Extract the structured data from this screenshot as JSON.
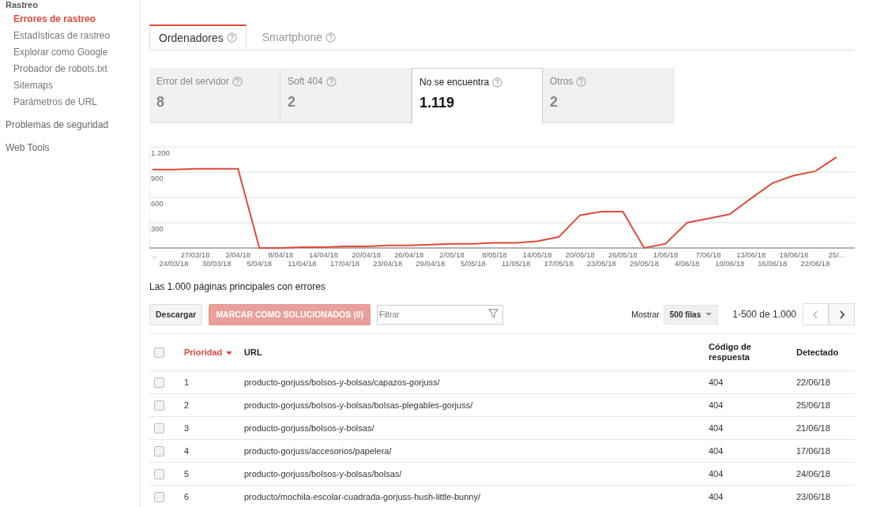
{
  "sidebar": {
    "section": "Rastreo",
    "items": [
      {
        "label": "Errores de rastreo",
        "selected": true
      },
      {
        "label": "Estadísticas de rastreo",
        "selected": false
      },
      {
        "label": "Explorar como Google",
        "selected": false
      },
      {
        "label": "Probador de robots.txt",
        "selected": false
      },
      {
        "label": "Sitemaps",
        "selected": false
      },
      {
        "label": "Parámetros de URL",
        "selected": false
      }
    ],
    "groups": [
      "Problemas de seguridad",
      "Web Tools"
    ]
  },
  "tabs": [
    {
      "label": "Ordenadores",
      "selected": true
    },
    {
      "label": "Smartphone",
      "selected": false
    }
  ],
  "categories": [
    {
      "label": "Error del servidor",
      "count": "8",
      "selected": false
    },
    {
      "label": "Soft 404",
      "count": "2",
      "selected": false
    },
    {
      "label": "No se encuentra",
      "count": "1.119",
      "selected": true
    },
    {
      "label": "Otros",
      "count": "2",
      "selected": false
    }
  ],
  "chart": {
    "chart_data": {
      "type": "line",
      "categories": [
        "..",
        "24/03/18",
        "27/03/18",
        "30/03/18",
        "2/04/18",
        "5/04/18",
        "8/04/18",
        "11/04/18",
        "14/04/18",
        "17/04/18",
        "20/04/18",
        "23/04/18",
        "26/04/18",
        "29/04/18",
        "2/05/18",
        "5/05/18",
        "8/05/18",
        "11/05/18",
        "14/05/18",
        "17/05/18",
        "20/05/18",
        "23/05/18",
        "26/05/18",
        "29/05/18",
        "1/06/18",
        "4/06/18",
        "7/06/18",
        "10/06/18",
        "13/06/18",
        "16/06/18",
        "19/06/18",
        "22/06/18",
        "25/..."
      ],
      "series": [
        {
          "color": "#dd4b39",
          "values": [
            930,
            930,
            940,
            940,
            940,
            0,
            0,
            10,
            10,
            20,
            20,
            30,
            30,
            40,
            50,
            50,
            60,
            60,
            80,
            130,
            390,
            430,
            430,
            0,
            50,
            300,
            350,
            400,
            590,
            770,
            860,
            910,
            1080
          ]
        }
      ],
      "ylim": [
        0,
        1200
      ],
      "grid": true,
      "yticks": [
        {
          "value": 300,
          "label": "300"
        },
        {
          "value": 600,
          "label": "600"
        },
        {
          "value": 900,
          "label": "900"
        },
        {
          "value": 1200,
          "label": "1.200"
        }
      ]
    }
  },
  "table_title": "Las 1.000 páginas principales con errores",
  "toolbar": {
    "download": "Descargar",
    "mark_fixed": "MARCAR COMO SOLUCIONADOS (0)",
    "filter_placeholder": "Filtrar",
    "show_label": "Mostrar",
    "rows_select": "500 filas",
    "range": "1-500 de 1.000"
  },
  "table": {
    "select_all_checked": false,
    "columns": [
      {
        "label": "Prioridad",
        "sorted": true
      },
      {
        "label": "URL",
        "sorted": false
      },
      {
        "label": "Código de respuesta",
        "sorted": false
      },
      {
        "label": "Detectado",
        "sorted": false
      }
    ],
    "rows": [
      {
        "checked": false,
        "priority": "1",
        "url": "producto-gorjuss/bolsos-y-bolsas/capazos-gorjuss/",
        "code": "404",
        "detected": "22/06/18"
      },
      {
        "checked": false,
        "priority": "2",
        "url": "producto-gorjuss/bolsos-y-bolsas/bolsas-plegables-gorjuss/",
        "code": "404",
        "detected": "25/06/18"
      },
      {
        "checked": false,
        "priority": "3",
        "url": "producto-gorjuss/bolsos-y-bolsas/",
        "code": "404",
        "detected": "21/06/18"
      },
      {
        "checked": false,
        "priority": "4",
        "url": "producto-gorjuss/accesorios/papelera/",
        "code": "404",
        "detected": "17/06/18"
      },
      {
        "checked": false,
        "priority": "5",
        "url": "producto-gorjuss/bolsos-y-bolsas/bolsas/",
        "code": "404",
        "detected": "24/06/18"
      },
      {
        "checked": false,
        "priority": "6",
        "url": "producto/mochila-escolar-cuadrada-gorjuss-hush-little-bunny/",
        "code": "404",
        "detected": "23/06/18"
      }
    ]
  }
}
